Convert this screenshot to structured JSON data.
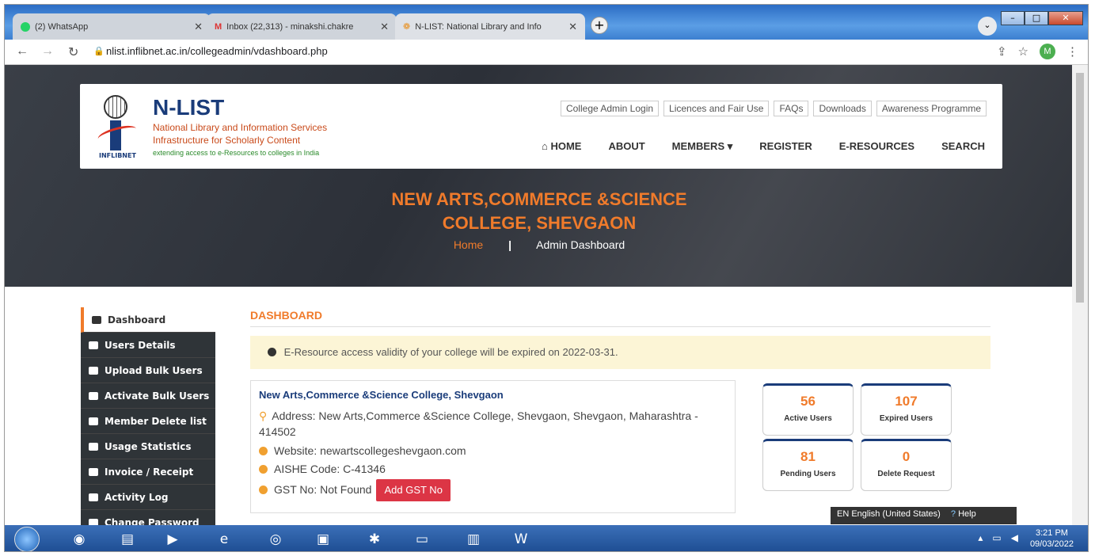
{
  "browser": {
    "tabs": [
      {
        "label": "(2) WhatsApp",
        "icon": "whatsapp-icon"
      },
      {
        "label": "Inbox (22,313) - minakshi.chakre",
        "icon": "gmail-icon"
      },
      {
        "label": "N-LIST: National Library and Info",
        "icon": "nlist-icon"
      }
    ],
    "url": "nlist.inflibnet.ac.in/collegeadmin/vdashboard.php",
    "profile_initial": "M"
  },
  "header": {
    "brand": "N-LIST",
    "subtitle1": "National Library and Information Services",
    "subtitle2": "Infrastructure for Scholarly Content",
    "tagline": "extending access to e-Resources to colleges in India",
    "logo_text": "INFLIBNET",
    "top_links": [
      "College Admin Login",
      "Licences and Fair Use",
      "FAQs",
      "Downloads",
      "Awareness Programme"
    ],
    "menu": [
      "HOME",
      "ABOUT",
      "MEMBERS",
      "REGISTER",
      "E-RESOURCES",
      "SEARCH"
    ]
  },
  "hero": {
    "college_line1": "NEW ARTS,COMMERCE &SCIENCE",
    "college_line2": "COLLEGE, SHEVGAON",
    "crumb_home": "Home",
    "crumb_sep": "|",
    "crumb_current": "Admin Dashboard"
  },
  "sidebar": [
    "Dashboard",
    "Users Details",
    "Upload Bulk Users",
    "Activate Bulk Users",
    "Member Delete list",
    "Usage Statistics",
    "Invoice / Receipt",
    "Activity Log",
    "Change Password"
  ],
  "dashboard": {
    "title": "DASHBOARD",
    "alert": "E-Resource access validity of your college will be expired on 2022-03-31.",
    "college_name": "New Arts,Commerce &Science College, Shevgaon",
    "address": "Address: New Arts,Commerce &Science College, Shevgaon, Shevgaon, Maharashtra - 414502",
    "website": "Website: newartscollegeshevgaon.com",
    "aishe": "AISHE Code: C-41346",
    "gst": "GST No: Not Found",
    "gst_button": "Add GST No",
    "stats": [
      {
        "value": "56",
        "label": "Active Users"
      },
      {
        "value": "107",
        "label": "Expired Users"
      },
      {
        "value": "81",
        "label": "Pending Users"
      },
      {
        "value": "0",
        "label": "Delete Request"
      }
    ]
  },
  "langbar": {
    "lang": "EN English (United States)",
    "help": "Help"
  },
  "taskbar": {
    "time": "3:21 PM",
    "date": "09/03/2022"
  }
}
